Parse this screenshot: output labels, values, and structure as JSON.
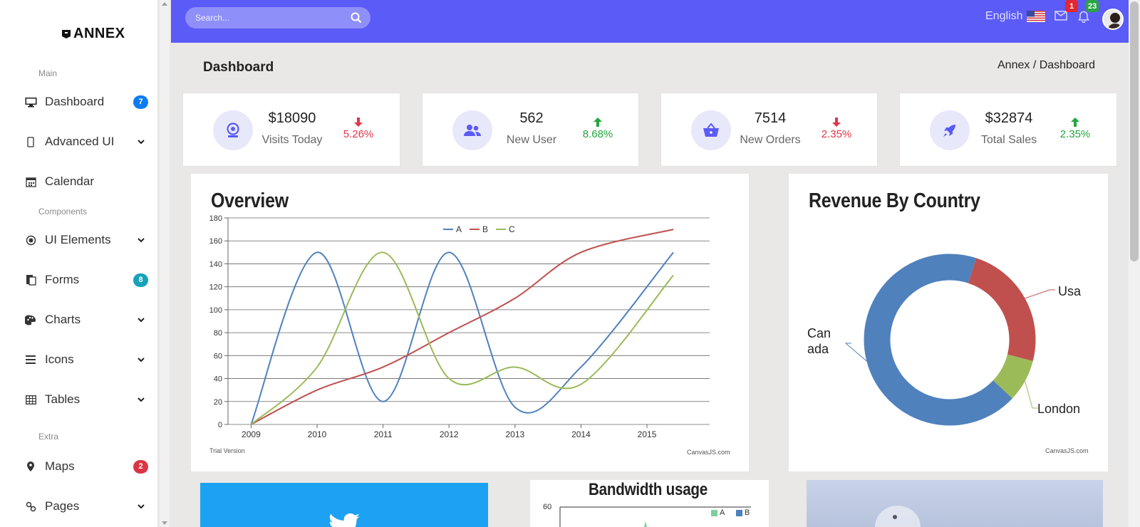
{
  "brand": {
    "name": "ANNEX"
  },
  "sidebar": {
    "sections": [
      "Main",
      "Components",
      "Extra"
    ],
    "items": [
      {
        "label": "Dashboard",
        "icon": "monitor-icon",
        "badge": "7",
        "badge_color": "#0d7cf2"
      },
      {
        "label": "Advanced UI",
        "icon": "mobile-icon",
        "chevron": true
      },
      {
        "label": "Calendar",
        "icon": "calendar-icon"
      },
      {
        "label": "UI Elements",
        "icon": "target-icon",
        "chevron": true
      },
      {
        "label": "Forms",
        "icon": "forms-icon",
        "badge": "8",
        "badge_color": "#17a2b8"
      },
      {
        "label": "Charts",
        "icon": "palette-icon",
        "chevron": true
      },
      {
        "label": "Icons",
        "icon": "bars-icon",
        "chevron": true
      },
      {
        "label": "Tables",
        "icon": "table-icon",
        "chevron": true
      },
      {
        "label": "Maps",
        "icon": "map-marker-icon",
        "badge": "2",
        "badge_color": "#dc3545"
      },
      {
        "label": "Pages",
        "icon": "link-icon",
        "chevron": true
      }
    ]
  },
  "topbar": {
    "search_placeholder": "Search...",
    "language": "English",
    "mail_badge": "1",
    "notif_badge": "23",
    "accent": "#5b5bf7"
  },
  "page": {
    "title": "Dashboard",
    "breadcrumb": "Annex / Dashboard"
  },
  "stats": [
    {
      "value": "$18090",
      "label": "Visits Today",
      "trend": "5.26%",
      "direction": "down",
      "icon": "webcam-icon"
    },
    {
      "value": "562",
      "label": "New User",
      "trend": "8.68%",
      "direction": "up",
      "icon": "users-icon"
    },
    {
      "value": "7514",
      "label": "New Orders",
      "trend": "2.35%",
      "direction": "down",
      "icon": "basket-icon"
    },
    {
      "value": "$32874",
      "label": "Total Sales",
      "trend": "2.35%",
      "direction": "up",
      "icon": "rocket-icon"
    }
  ],
  "overview": {
    "title": "Overview",
    "trial": "Trial Version",
    "credit": "CanvasJS.com"
  },
  "revenue": {
    "title": "Revenue By Country",
    "credit": "CanvasJS.com"
  },
  "bandwidth": {
    "title": "Bandwidth usage",
    "ytick": "60",
    "legend": [
      "A",
      "B"
    ]
  },
  "chart_data": [
    {
      "type": "line",
      "title": "Overview",
      "x": [
        2009,
        2010,
        2011,
        2012,
        2013,
        2014,
        2015
      ],
      "ylim": [
        0,
        180
      ],
      "yticks": [
        0,
        20,
        40,
        60,
        80,
        100,
        120,
        140,
        160,
        180
      ],
      "legend_position": "top-center",
      "grid": true,
      "series": [
        {
          "name": "A",
          "color": "#4f81bd",
          "x": [
            2009,
            2010,
            2011,
            2012,
            2013,
            2014,
            2015.4
          ],
          "values": [
            0,
            150,
            20,
            150,
            15,
            50,
            150
          ]
        },
        {
          "name": "B",
          "color": "#c0504d",
          "x": [
            2009,
            2010,
            2011,
            2012,
            2013,
            2014,
            2015.4
          ],
          "values": [
            0,
            30,
            50,
            80,
            110,
            150,
            170
          ]
        },
        {
          "name": "C",
          "color": "#9bbb59",
          "x": [
            2009,
            2010,
            2011,
            2012,
            2013,
            2014,
            2015.4
          ],
          "values": [
            0,
            50,
            150,
            40,
            50,
            35,
            130
          ]
        }
      ]
    },
    {
      "type": "pie",
      "title": "Revenue By Country",
      "donut": true,
      "slices": [
        {
          "label": "Usa",
          "value": 24,
          "color": "#c0504d"
        },
        {
          "label": "London",
          "value": 8,
          "color": "#9bbb59"
        },
        {
          "label": "Can ada",
          "value": 68,
          "color": "#4f81bd"
        }
      ]
    }
  ]
}
